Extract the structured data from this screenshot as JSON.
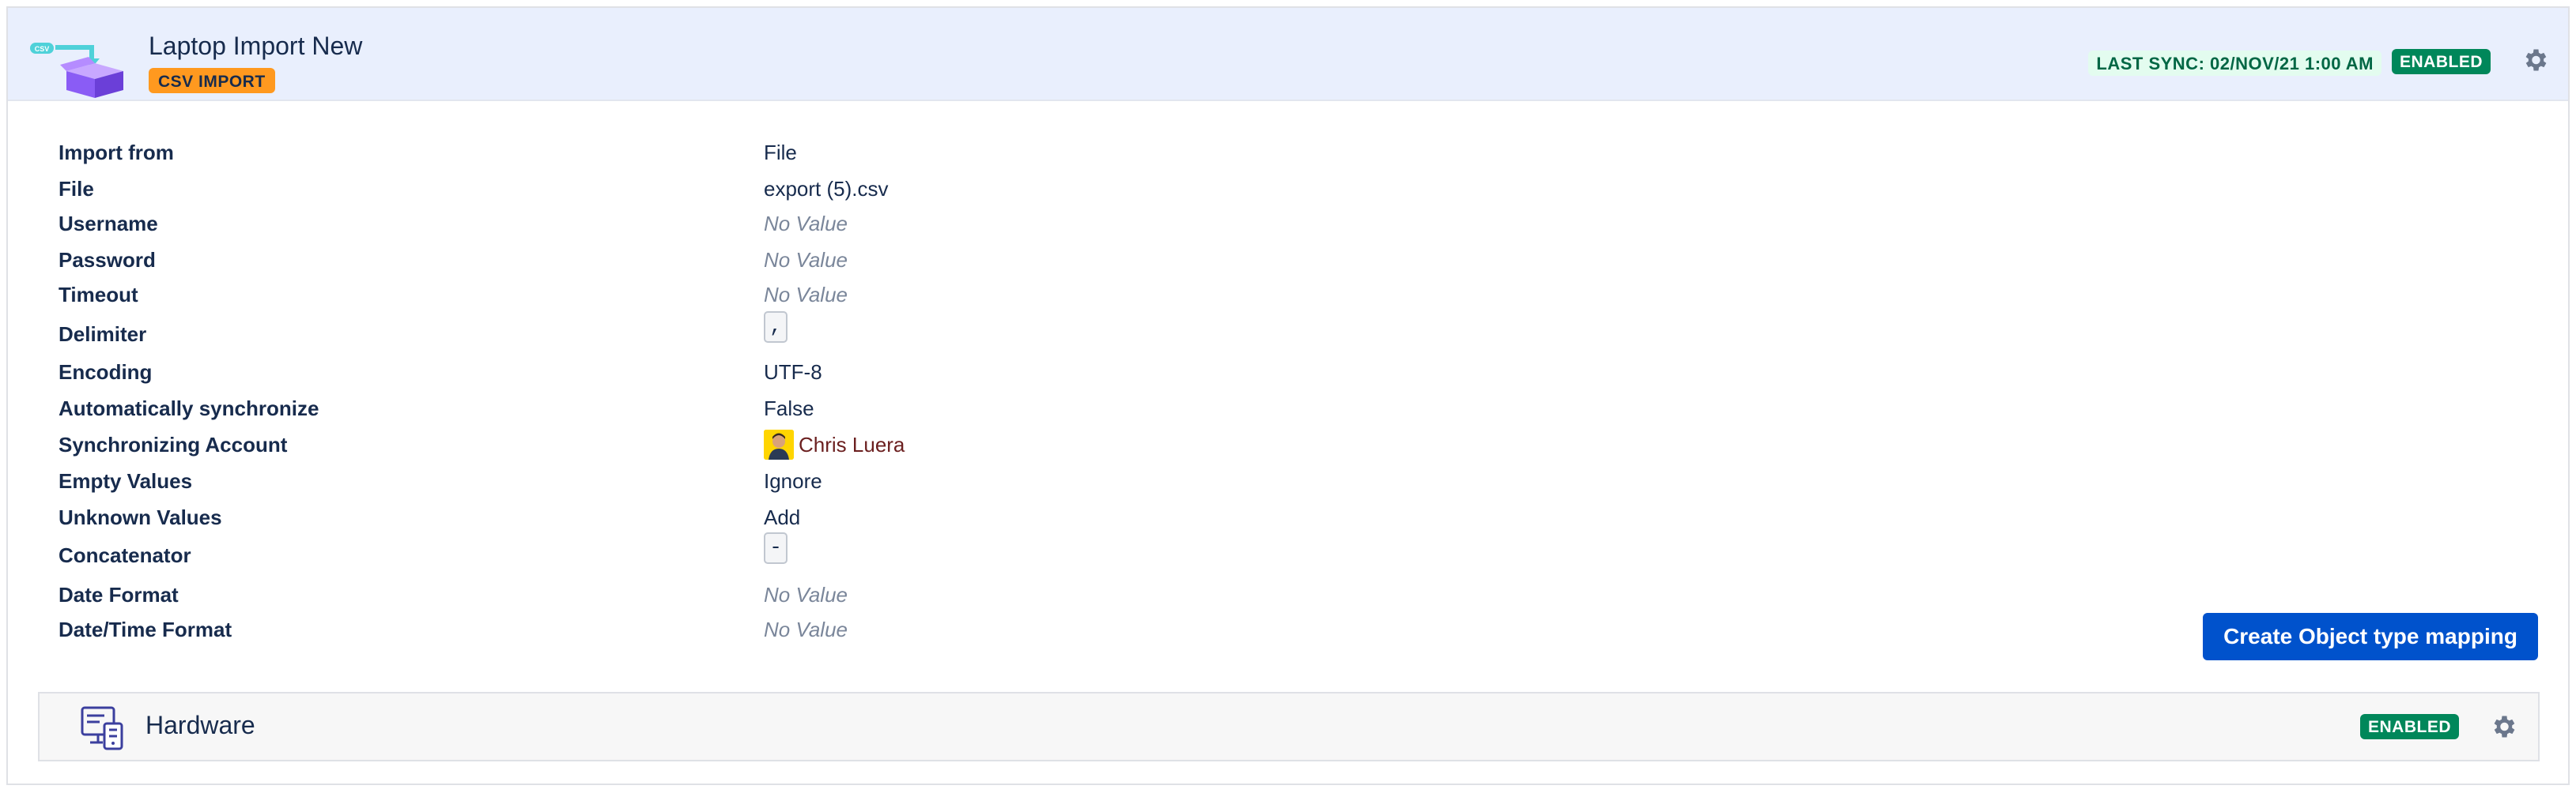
{
  "header": {
    "title": "Laptop Import New",
    "type_badge": "CSV IMPORT",
    "last_sync": "LAST SYNC: 02/NOV/21 1:00 AM",
    "status": "ENABLED",
    "logo_icon": "csv-box-icon",
    "settings_icon": "gear-icon"
  },
  "fields": [
    {
      "label": "Import from",
      "value": "File",
      "kind": "text"
    },
    {
      "label": "File",
      "value": "export (5).csv",
      "kind": "text"
    },
    {
      "label": "Username",
      "value": "No Value",
      "kind": "empty"
    },
    {
      "label": "Password",
      "value": "No Value",
      "kind": "empty"
    },
    {
      "label": "Timeout",
      "value": "No Value",
      "kind": "empty"
    },
    {
      "label": "Delimiter",
      "value": ",",
      "kind": "code"
    },
    {
      "label": "Encoding",
      "value": "UTF-8",
      "kind": "text"
    },
    {
      "label": "Automatically synchronize",
      "value": "False",
      "kind": "text"
    },
    {
      "label": "Synchronizing Account",
      "value": "Chris Luera",
      "kind": "user"
    },
    {
      "label": "Empty Values",
      "value": "Ignore",
      "kind": "text"
    },
    {
      "label": "Unknown Values",
      "value": "Add",
      "kind": "text"
    },
    {
      "label": "Concatenator",
      "value": "-",
      "kind": "code"
    },
    {
      "label": "Date Format",
      "value": "No Value",
      "kind": "empty"
    },
    {
      "label": "Date/Time Format",
      "value": "No Value",
      "kind": "empty"
    }
  ],
  "actions": {
    "create_mapping": "Create Object type mapping"
  },
  "object_type": {
    "name": "Hardware",
    "status": "ENABLED",
    "icon": "hardware-icon"
  },
  "colors": {
    "header_bg": "#e9effd",
    "badge_orange": "#ff991f",
    "enabled_green": "#00875a",
    "primary_blue": "#0052cc"
  }
}
